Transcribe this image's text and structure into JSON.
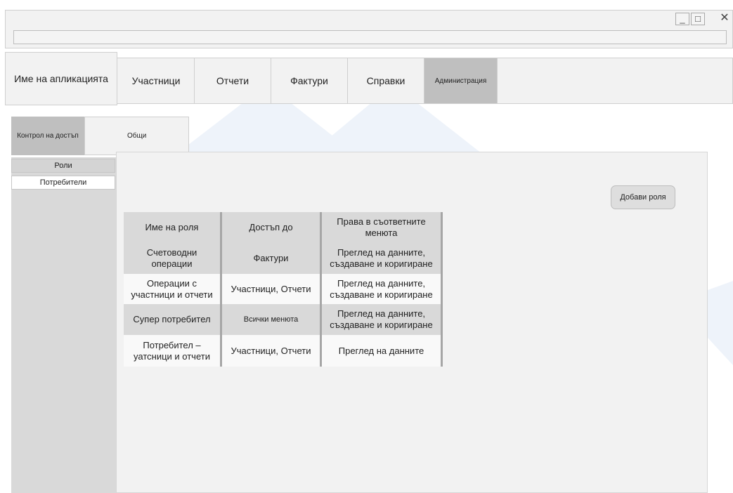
{
  "window": {
    "minimize_glyph": "_",
    "maximize_glyph": "□",
    "close_glyph": "✕"
  },
  "app_name": "Име на апликацията",
  "menu": {
    "items": [
      {
        "label": "Участници"
      },
      {
        "label": "Отчети"
      },
      {
        "label": "Фактури"
      },
      {
        "label": "Справки"
      },
      {
        "label": "Администрация"
      }
    ],
    "active": "Администрация"
  },
  "subtabs": [
    {
      "label": "Контрол на достъп"
    },
    {
      "label": "Общи"
    }
  ],
  "sidebar": {
    "items": [
      {
        "label": "Роли"
      },
      {
        "label": "Потребители"
      }
    ]
  },
  "add_role_button": "Добави роля",
  "roles_table": {
    "headers": [
      "Име на роля",
      "Достъп до",
      "Права в съответните менюта"
    ],
    "rows": [
      [
        "Счетоводни операции",
        "Фактури",
        "Преглед на данните, създаване и коригиране"
      ],
      [
        "Операции с участници и отчети",
        "Участници, Отчети",
        "Преглед на данните, създаване и коригиране"
      ],
      [
        "Супер потребител",
        "Всички менюта",
        "Преглед на данните, създаване и коригиране"
      ],
      [
        "Потребител – уатсници и отчети",
        "Участници, Отчети",
        "Преглед на данните"
      ]
    ]
  },
  "colors": {
    "active_tab": "#bfbfbf",
    "panel": "#f2f2f2",
    "sidebar": "#d9d9d9",
    "watermark": "#e6eef8"
  }
}
